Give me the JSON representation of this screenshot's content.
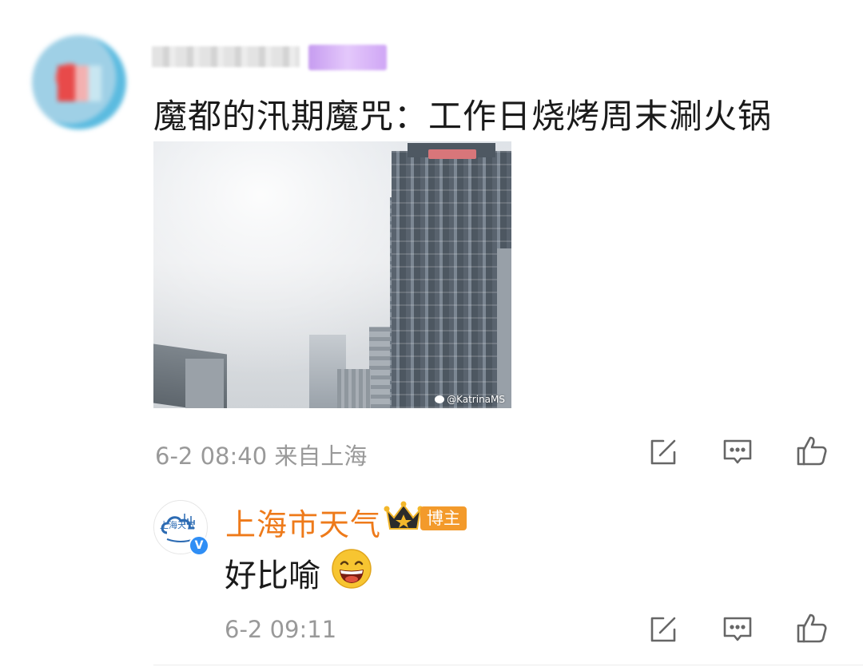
{
  "post": {
    "username_blurred": "",
    "tag_blurred": "",
    "text": "魔都的汛期魔咒：工作日烧烤周末涮火锅",
    "photo": {
      "watermark": "@KatrinaMS",
      "tower_sign": ""
    },
    "timestamp": "6-2 08:40",
    "location": "来自上海",
    "actions": [
      "share-icon",
      "comment-icon",
      "like-icon"
    ]
  },
  "reply": {
    "avatar_text": "上海天气",
    "username": "上海市天气",
    "badge": "博主",
    "text": "好比喻",
    "emoji": "laughing-emoji",
    "timestamp": "6-2 09:11",
    "actions": [
      "share-icon",
      "comment-icon",
      "like-icon"
    ]
  },
  "colors": {
    "reply_name": "#ee7a1a",
    "badge_bg": "#f39a2b",
    "meta_text": "#999999",
    "verified": "#2f8ef5"
  }
}
